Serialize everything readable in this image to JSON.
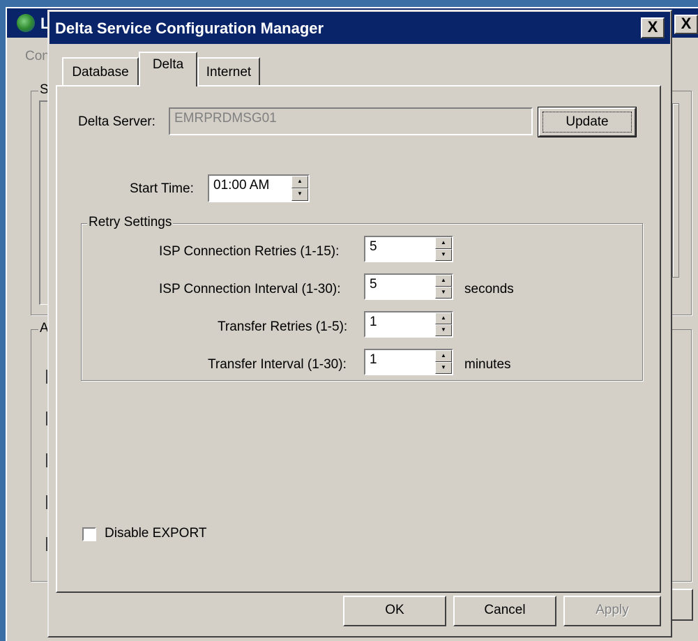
{
  "background_window": {
    "title_char": "L",
    "menu_text": "Con",
    "group1_label": "S",
    "group2_label": "A",
    "close_glyph": "X"
  },
  "dialog": {
    "title": "Delta Service Configuration Manager",
    "close_glyph": "X"
  },
  "tabs": [
    {
      "label": "Database",
      "selected": false
    },
    {
      "label": "Delta",
      "selected": true
    },
    {
      "label": "Internet",
      "selected": false
    }
  ],
  "delta": {
    "server_label": "Delta Server:",
    "server_value": "EMRPRDMSG01",
    "update_button": "Update",
    "start_time_label": "Start Time:",
    "start_time_value": "01:00 AM"
  },
  "retry": {
    "legend": "Retry Settings",
    "isp_retries_label": "ISP Connection Retries (1-15):",
    "isp_retries_value": "5",
    "isp_interval_label": "ISP Connection Interval (1-30):",
    "isp_interval_value": "5",
    "isp_interval_unit": "seconds",
    "transfer_retries_label": "Transfer Retries (1-5):",
    "transfer_retries_value": "1",
    "transfer_interval_label": "Transfer Interval (1-30):",
    "transfer_interval_value": "1",
    "transfer_interval_unit": "minutes"
  },
  "disable_export": {
    "label": "Disable EXPORT",
    "checked": false
  },
  "footer": {
    "ok": "OK",
    "cancel": "Cancel",
    "apply": "Apply"
  },
  "colors": {
    "titlebar": "#0a246a",
    "face": "#d4d0c8",
    "desktop": "#3a6ea5"
  }
}
